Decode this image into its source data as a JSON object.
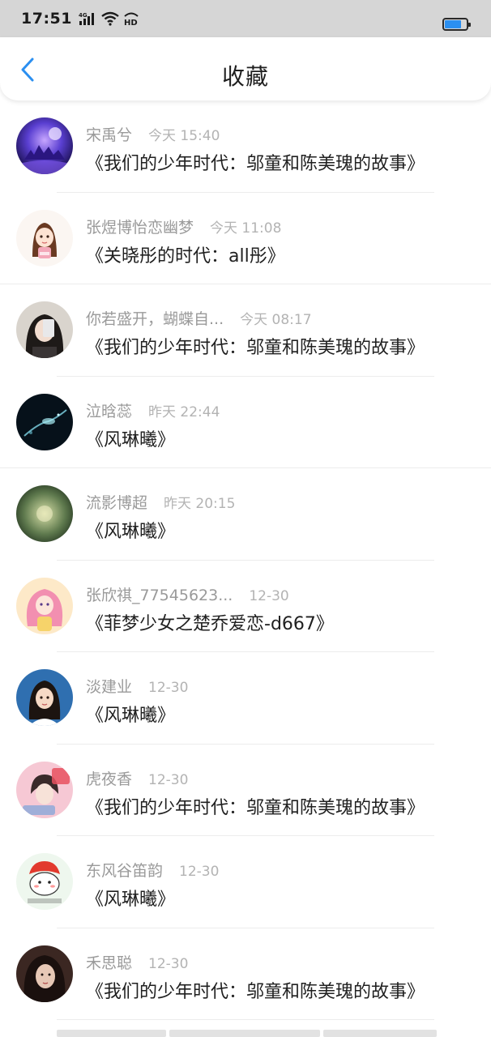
{
  "status_bar": {
    "time": "17:51",
    "network": "4G",
    "hd_label": "HD",
    "battery_level": 0.75
  },
  "header": {
    "title": "收藏",
    "back_icon": "chevron-left-icon",
    "accent_color": "#2b8ff0"
  },
  "favorites": [
    {
      "username": "宋禹兮",
      "time": "今天 15:40",
      "title": "《我们的少年时代：邬童和陈美瑰的故事》"
    },
    {
      "username": "张煜博怡恋幽梦",
      "time": "今天 11:08",
      "title": "《关晓彤的时代：all彤》"
    },
    {
      "username": "你若盛开，蝴蝶自...",
      "time": "今天 08:17",
      "title": "《我们的少年时代：邬童和陈美瑰的故事》"
    },
    {
      "username": "泣晗蕊",
      "time": "昨天 22:44",
      "title": "《风琳曦》"
    },
    {
      "username": "流影博超",
      "time": "昨天 20:15",
      "title": "《风琳曦》"
    },
    {
      "username": "张欣祺_77545623...",
      "time": "12-30",
      "title": "《菲梦少女之楚乔爱恋-d667》"
    },
    {
      "username": "淡建业",
      "time": "12-30",
      "title": "《风琳曦》"
    },
    {
      "username": "虎夜香",
      "time": "12-30",
      "title": "《我们的少年时代：邬童和陈美瑰的故事》"
    },
    {
      "username": "东风谷笛韵",
      "time": "12-30",
      "title": "《风琳曦》"
    },
    {
      "username": "禾思聪",
      "time": "12-30",
      "title": "《我们的少年时代：邬童和陈美瑰的故事》"
    }
  ]
}
